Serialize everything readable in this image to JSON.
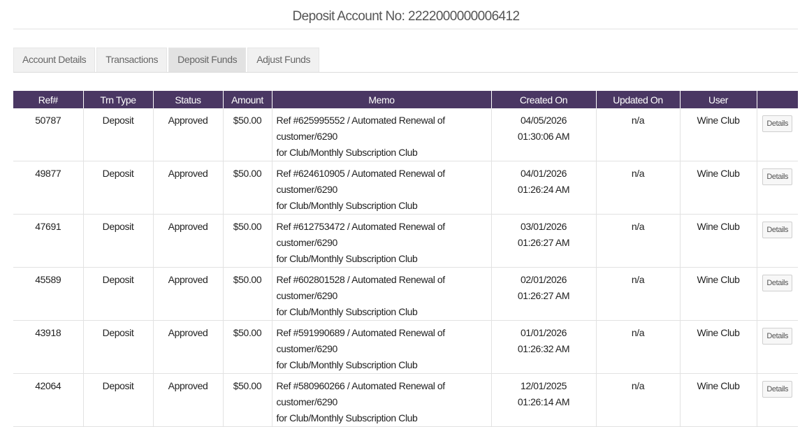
{
  "header": {
    "title": "Deposit Account No: 2222000000006412"
  },
  "tabs": [
    {
      "label": "Account Details"
    },
    {
      "label": "Transactions"
    },
    {
      "label": "Deposit Funds",
      "active": true
    },
    {
      "label": "Adjust Funds"
    }
  ],
  "table": {
    "columns": [
      "Ref#",
      "Trn Type",
      "Status",
      "Amount",
      "Memo",
      "Created On",
      "Updated On",
      "User",
      ""
    ],
    "rows": [
      {
        "ref": "50787",
        "type": "Deposit",
        "status": "Approved",
        "amount": "$50.00",
        "memo1": "Ref #625995552 / Automated Renewal of customer/6290",
        "memo2": "for Club/Monthly Subscription Club",
        "created_date": "04/05/2026",
        "created_time": "01:30:06 AM",
        "updated": "n/a",
        "user": "Wine Club",
        "action": "Details"
      },
      {
        "ref": "49877",
        "type": "Deposit",
        "status": "Approved",
        "amount": "$50.00",
        "memo1": "Ref #624610905 / Automated Renewal of customer/6290",
        "memo2": "for Club/Monthly Subscription Club",
        "created_date": "04/01/2026",
        "created_time": "01:26:24 AM",
        "updated": "n/a",
        "user": "Wine Club",
        "action": "Details"
      },
      {
        "ref": "47691",
        "type": "Deposit",
        "status": "Approved",
        "amount": "$50.00",
        "memo1": "Ref #612753472 / Automated Renewal of customer/6290",
        "memo2": "for Club/Monthly Subscription Club",
        "created_date": "03/01/2026",
        "created_time": "01:26:27 AM",
        "updated": "n/a",
        "user": "Wine Club",
        "action": "Details"
      },
      {
        "ref": "45589",
        "type": "Deposit",
        "status": "Approved",
        "amount": "$50.00",
        "memo1": "Ref #602801528 / Automated Renewal of customer/6290",
        "memo2": "for Club/Monthly Subscription Club",
        "created_date": "02/01/2026",
        "created_time": "01:26:27 AM",
        "updated": "n/a",
        "user": "Wine Club",
        "action": "Details"
      },
      {
        "ref": "43918",
        "type": "Deposit",
        "status": "Approved",
        "amount": "$50.00",
        "memo1": "Ref #591990689 / Automated Renewal of customer/6290",
        "memo2": "for Club/Monthly Subscription Club",
        "created_date": "01/01/2026",
        "created_time": "01:26:32 AM",
        "updated": "n/a",
        "user": "Wine Club",
        "action": "Details"
      },
      {
        "ref": "42064",
        "type": "Deposit",
        "status": "Approved",
        "amount": "$50.00",
        "memo1": "Ref #580960266 / Automated Renewal of customer/6290",
        "memo2": "for Club/Monthly Subscription Club",
        "created_date": "12/01/2025",
        "created_time": "01:26:14 AM",
        "updated": "n/a",
        "user": "Wine Club",
        "action": "Details"
      }
    ]
  },
  "colors": {
    "header_bg": "#4a3763",
    "tab_bg": "#f1f1f1",
    "tab_active_bg": "#e2e2e2",
    "border": "#e2e2e2"
  }
}
